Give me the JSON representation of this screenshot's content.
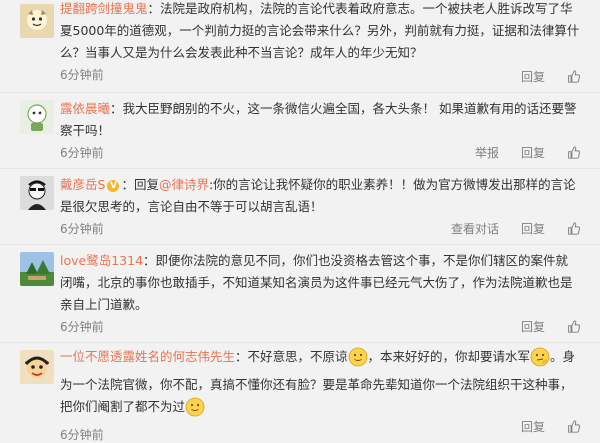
{
  "comments": [
    {
      "username": "提翻跨剑撞鬼鬼",
      "text": "：法院是政府机构，法院的言论代表着政府意志。一个被扶老人胜诉改写了华夏5000年的道德观，一个判前力挺的言论会带来什么？另外，判前就有力挺，证据和法律算什么？当事人又是为什么会发表此种不当言论？成年人的年少无知？",
      "time": "6分钟前",
      "actions": [
        "回复"
      ]
    },
    {
      "username": "露依晨曦",
      "text": "：我大臣野朗别的不火，这一条微信火遍全国，各大头条！ 如果道歉有用的话还要警察干吗！",
      "time": "6分钟前",
      "actions": [
        "举报",
        "回复"
      ]
    },
    {
      "username": "戴彦岳S",
      "verified": "V",
      "prefix": "：回复",
      "mention": "@律诗界",
      "text": ":你的言论让我怀疑你的职业素养！！做为官方微博发出那样的言论是很欠思考的，言论自由不等于可以胡言乱语！",
      "time": "6分钟前",
      "actions": [
        "查看对话",
        "回复"
      ]
    },
    {
      "username": "love鹭岛1314",
      "text": "：即便你法院的意见不同，你们也没资格去管这个事，不是你们辖区的案件就闭嘴，北京的事你也敢插手，不知道某知名演员为这件事已经元气大伤了，作为法院道歉也是亲自上门道歉。",
      "time": "6分钟前",
      "actions": [
        "回复"
      ]
    },
    {
      "username": "一位不愿透露姓名的何志伟先生",
      "text_a": "：不好意思，不原谅",
      "text_b": "，本来好好的，你却要请水军",
      "text_c": "。身为一个法院官微，你不配，真搞不懂你还有脸？要是革命先辈知道你一个法院组织干这种事，把你们阉割了都不为过",
      "time": "6分钟前",
      "actions": [
        "回复"
      ]
    }
  ],
  "icons": {
    "like": "thumbs-up-icon",
    "emoji": "smiley-face-emoji"
  },
  "colors": {
    "username": "#eb7350",
    "text": "#333333",
    "meta": "#808080",
    "background": "#f2f2f2"
  }
}
